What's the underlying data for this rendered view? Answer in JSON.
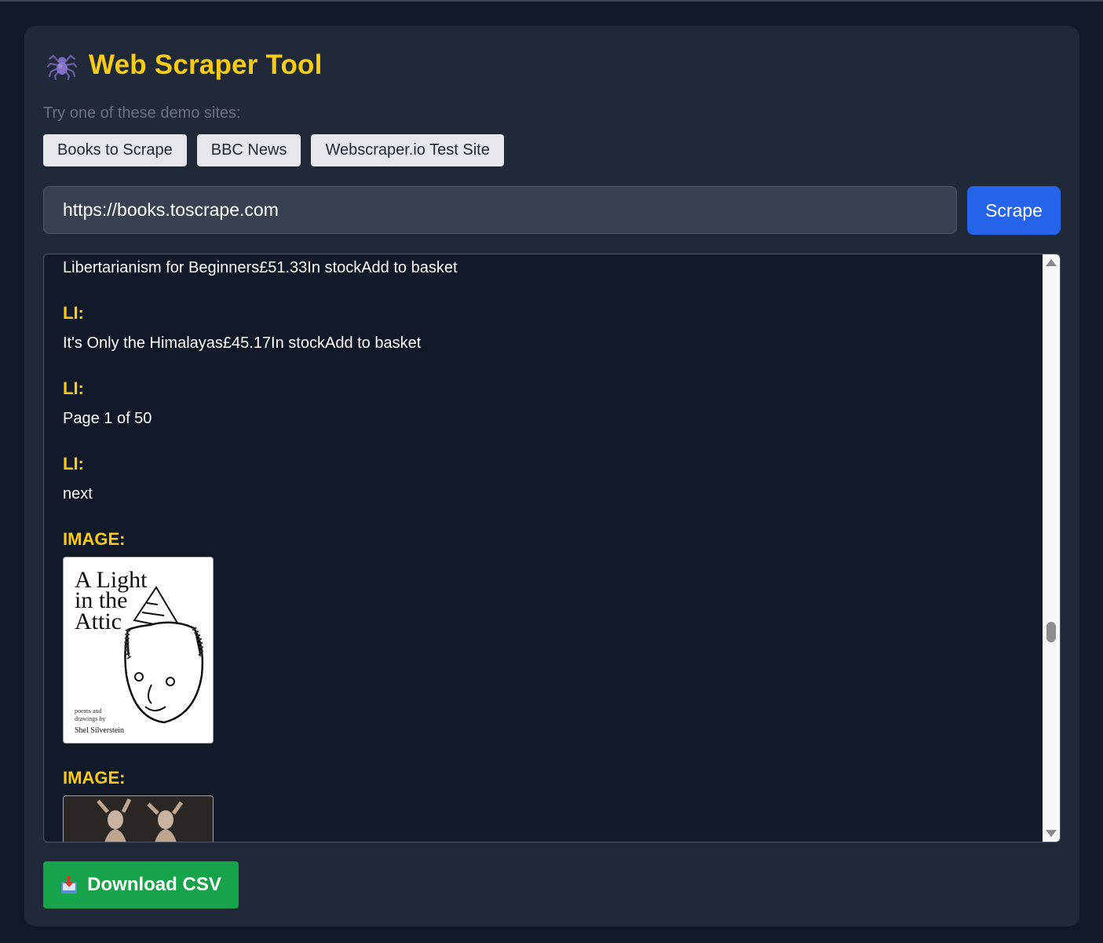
{
  "app": {
    "title": "Web Scraper Tool",
    "icon": "spider-icon",
    "subtitle": "Try one of these demo sites:"
  },
  "demo_sites": [
    {
      "label": "Books to Scrape"
    },
    {
      "label": "BBC News"
    },
    {
      "label": "Webscraper.io Test Site"
    }
  ],
  "url_input": {
    "value": "https://books.toscrape.com"
  },
  "scrape_button": {
    "label": "Scrape"
  },
  "results": {
    "items": [
      {
        "type": "text",
        "text": "Libertarianism for Beginners£51.33In stockAdd to basket"
      },
      {
        "type": "label",
        "text": "LI:"
      },
      {
        "type": "text",
        "text": "It's Only the Himalayas£45.17In stockAdd to basket"
      },
      {
        "type": "label",
        "text": "LI:"
      },
      {
        "type": "text",
        "text": "Page 1 of 50"
      },
      {
        "type": "label",
        "text": "LI:"
      },
      {
        "type": "text",
        "text": "next"
      },
      {
        "type": "label",
        "text": "IMAGE:"
      },
      {
        "type": "image",
        "book_cover": {
          "title_lines": [
            "A Light",
            "in the",
            "Attic"
          ],
          "caption_lines": [
            "poems and",
            "drawings by",
            "Shel Silverstein"
          ]
        }
      },
      {
        "type": "label",
        "text": "IMAGE:"
      },
      {
        "type": "image",
        "book_cover": null
      }
    ]
  },
  "download_button": {
    "label": "Download CSV",
    "icon": "download-tray-icon"
  },
  "colors": {
    "background": "#111827",
    "card": "#1f2937",
    "title": "#facc15",
    "primary": "#2563eb",
    "success": "#16a34a"
  }
}
